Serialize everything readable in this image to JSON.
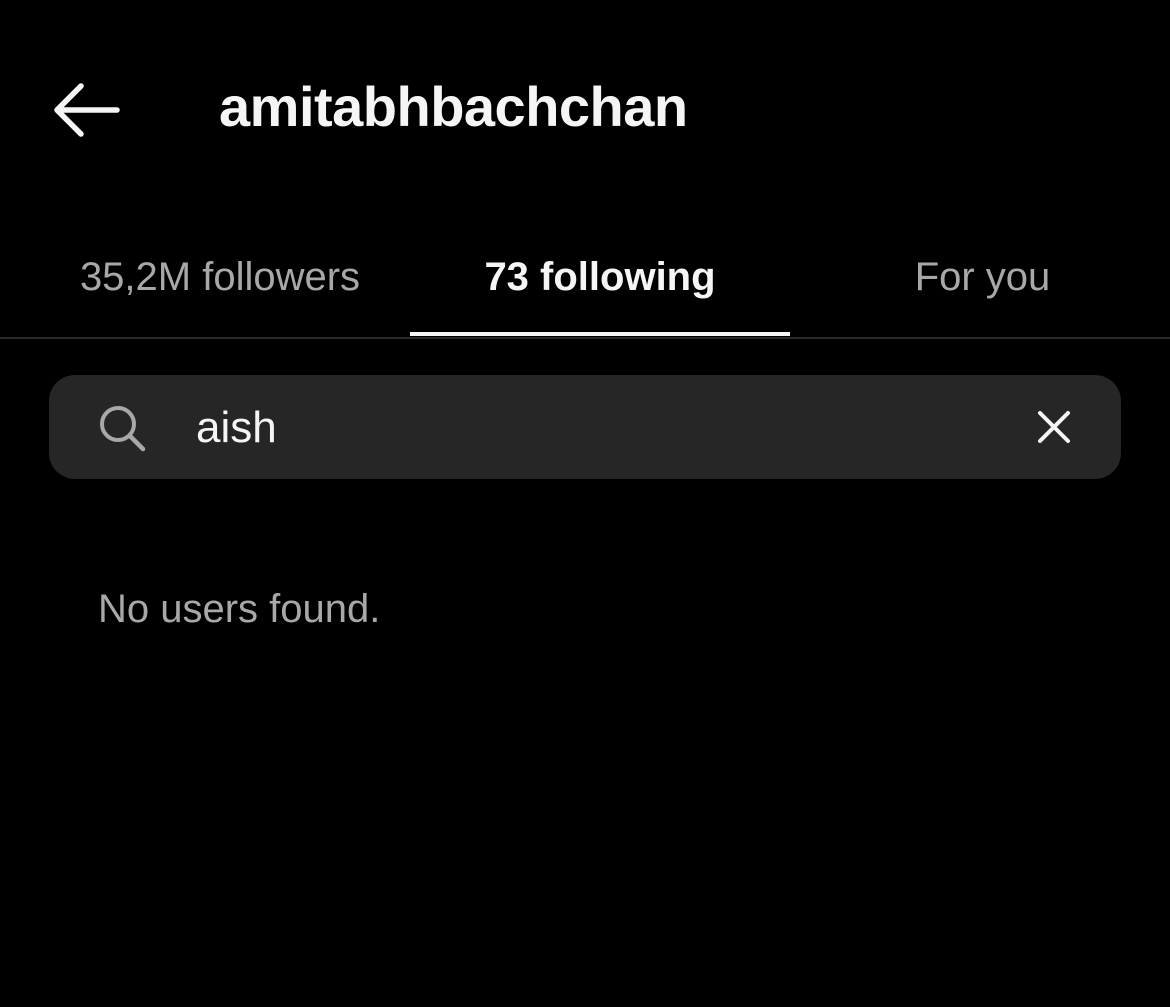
{
  "header": {
    "back_icon": "arrow-left-icon",
    "title": "amitabhbachchan"
  },
  "tabs": [
    {
      "label": "35,2M followers",
      "active": false
    },
    {
      "label": "73 following",
      "active": true
    },
    {
      "label": "For you",
      "active": false
    }
  ],
  "search": {
    "icon": "search-icon",
    "value": "aish",
    "clear_icon": "close-icon"
  },
  "results": {
    "empty_message": "No users found."
  },
  "colors": {
    "background": "#000000",
    "primary_text": "#f5f5f5",
    "secondary_text": "#a8a8a8",
    "search_background": "#262626",
    "divider": "#2a2a2a"
  }
}
